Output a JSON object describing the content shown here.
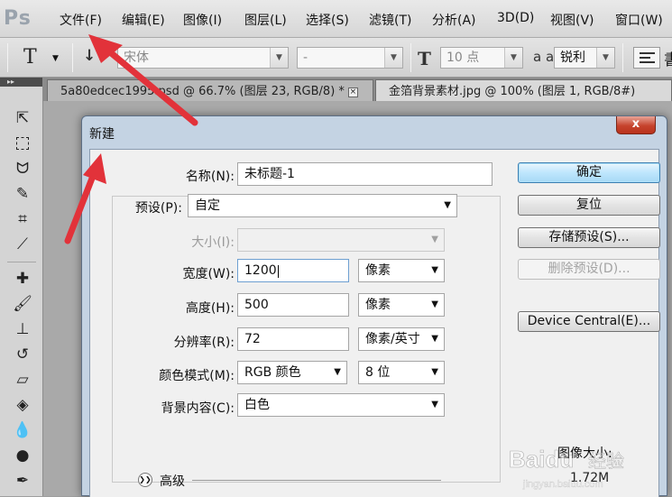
{
  "app": {
    "logo": "Ps",
    "menu": [
      "文件(F)",
      "编辑(E)",
      "图像(I)",
      "图层(L)",
      "选择(S)",
      "滤镜(T)",
      "分析(A)",
      "3D(D)",
      "视图(V)",
      "窗口(W)"
    ]
  },
  "options": {
    "tool_glyph": "T",
    "font_family": "宋体",
    "font_style": "-",
    "font_size": "10 点",
    "aa_glyph": "a a",
    "antialias": "锐利",
    "overflow_glyph": "書"
  },
  "tabs": [
    {
      "label": "5a80edcec1995.psd @ 66.7% (图层 23, RGB/8) *"
    },
    {
      "label": "金箔背景素材.jpg @ 100% (图层 1, RGB/8#)"
    }
  ],
  "tabs_close": "×",
  "dialog": {
    "title": "新建",
    "close": "x",
    "name_label": "名称(N):",
    "name_value": "未标题-1",
    "preset_label": "预设(P):",
    "preset_value": "自定",
    "size_label": "大小(I):",
    "size_value": "",
    "width_label": "宽度(W):",
    "width_value": "1200",
    "width_unit": "像素",
    "height_label": "高度(H):",
    "height_value": "500",
    "height_unit": "像素",
    "resolution_label": "分辨率(R):",
    "resolution_value": "72",
    "resolution_unit": "像素/英寸",
    "color_mode_label": "颜色模式(M):",
    "color_mode_value": "RGB 颜色",
    "bit_depth": "8 位",
    "background_label": "背景内容(C):",
    "background_value": "白色",
    "advanced_label": "高级",
    "image_size_label": "图像大小:",
    "image_size_value": "1.72M",
    "buttons": {
      "ok": "确定",
      "reset": "复位",
      "save_preset": "存储预设(S)...",
      "delete_preset": "删除预设(D)...",
      "device_central": "Device Central(E)..."
    }
  },
  "colors": {
    "arrow": "#e2323a",
    "dialog_frame": "#c4d3e3",
    "close_button": "#c6432d"
  }
}
